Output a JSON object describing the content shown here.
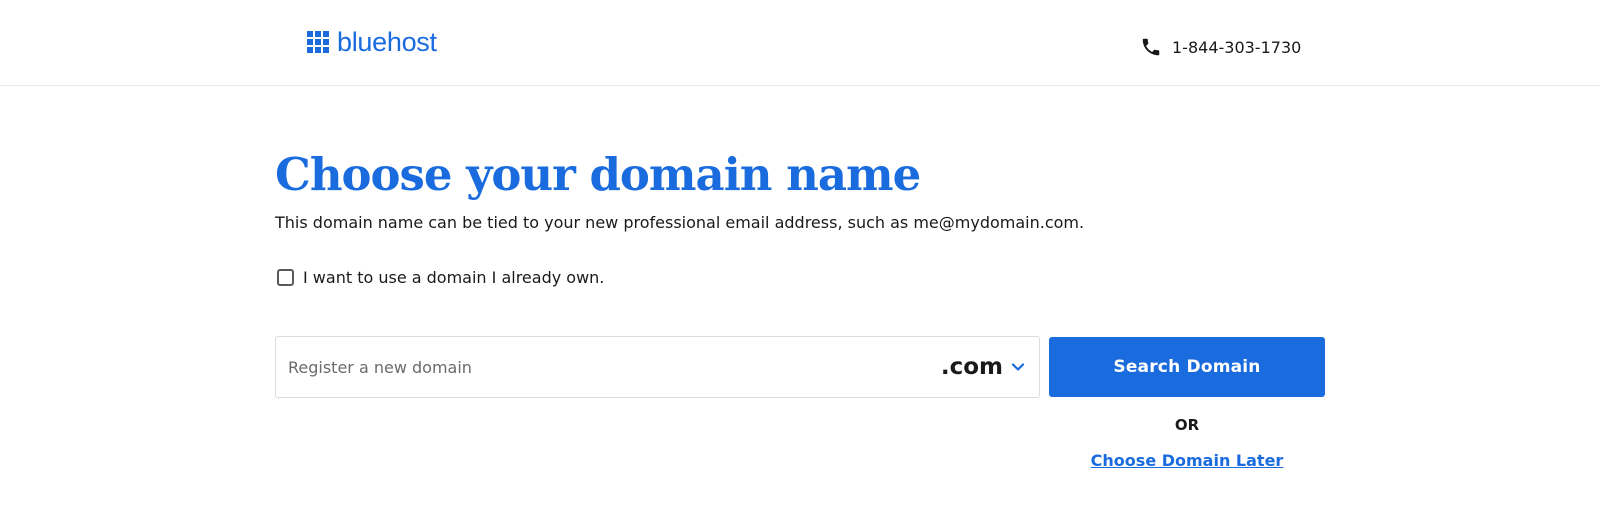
{
  "header": {
    "logo_text": "bluehost",
    "phone": "1-844-303-1730"
  },
  "main": {
    "title": "Choose your domain name",
    "subtitle": "This domain name can be tied to your new professional email address, such as me@mydomain.com.",
    "own_domain_label": "I want to use a domain I already own.",
    "own_domain_checked": false,
    "domain_input": {
      "value": "",
      "placeholder": "Register a new domain"
    },
    "tld_selected": ".com",
    "search_button": "Search Domain",
    "or_text": "OR",
    "choose_later": "Choose Domain Later"
  },
  "colors": {
    "brand_blue": "#196bde",
    "text": "#1a1a1a",
    "border": "#dcdcdc"
  },
  "icons": {
    "logo": "grid-icon",
    "phone": "phone-icon",
    "tld": "chevron-down-icon"
  }
}
